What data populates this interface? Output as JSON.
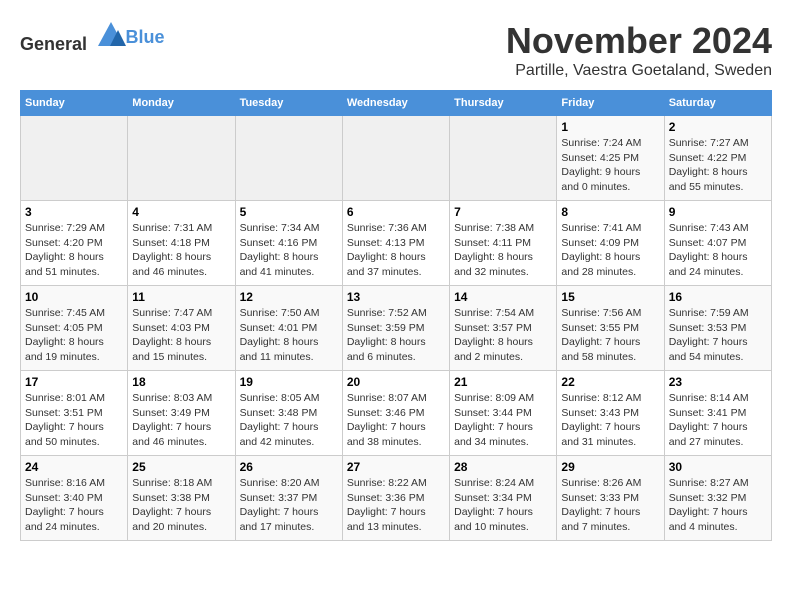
{
  "header": {
    "logo_general": "General",
    "logo_blue": "Blue",
    "month": "November 2024",
    "location": "Partille, Vaestra Goetaland, Sweden"
  },
  "weekdays": [
    "Sunday",
    "Monday",
    "Tuesday",
    "Wednesday",
    "Thursday",
    "Friday",
    "Saturday"
  ],
  "weeks": [
    [
      {
        "day": "",
        "info": ""
      },
      {
        "day": "",
        "info": ""
      },
      {
        "day": "",
        "info": ""
      },
      {
        "day": "",
        "info": ""
      },
      {
        "day": "",
        "info": ""
      },
      {
        "day": "1",
        "info": "Sunrise: 7:24 AM\nSunset: 4:25 PM\nDaylight: 9 hours\nand 0 minutes."
      },
      {
        "day": "2",
        "info": "Sunrise: 7:27 AM\nSunset: 4:22 PM\nDaylight: 8 hours\nand 55 minutes."
      }
    ],
    [
      {
        "day": "3",
        "info": "Sunrise: 7:29 AM\nSunset: 4:20 PM\nDaylight: 8 hours\nand 51 minutes."
      },
      {
        "day": "4",
        "info": "Sunrise: 7:31 AM\nSunset: 4:18 PM\nDaylight: 8 hours\nand 46 minutes."
      },
      {
        "day": "5",
        "info": "Sunrise: 7:34 AM\nSunset: 4:16 PM\nDaylight: 8 hours\nand 41 minutes."
      },
      {
        "day": "6",
        "info": "Sunrise: 7:36 AM\nSunset: 4:13 PM\nDaylight: 8 hours\nand 37 minutes."
      },
      {
        "day": "7",
        "info": "Sunrise: 7:38 AM\nSunset: 4:11 PM\nDaylight: 8 hours\nand 32 minutes."
      },
      {
        "day": "8",
        "info": "Sunrise: 7:41 AM\nSunset: 4:09 PM\nDaylight: 8 hours\nand 28 minutes."
      },
      {
        "day": "9",
        "info": "Sunrise: 7:43 AM\nSunset: 4:07 PM\nDaylight: 8 hours\nand 24 minutes."
      }
    ],
    [
      {
        "day": "10",
        "info": "Sunrise: 7:45 AM\nSunset: 4:05 PM\nDaylight: 8 hours\nand 19 minutes."
      },
      {
        "day": "11",
        "info": "Sunrise: 7:47 AM\nSunset: 4:03 PM\nDaylight: 8 hours\nand 15 minutes."
      },
      {
        "day": "12",
        "info": "Sunrise: 7:50 AM\nSunset: 4:01 PM\nDaylight: 8 hours\nand 11 minutes."
      },
      {
        "day": "13",
        "info": "Sunrise: 7:52 AM\nSunset: 3:59 PM\nDaylight: 8 hours\nand 6 minutes."
      },
      {
        "day": "14",
        "info": "Sunrise: 7:54 AM\nSunset: 3:57 PM\nDaylight: 8 hours\nand 2 minutes."
      },
      {
        "day": "15",
        "info": "Sunrise: 7:56 AM\nSunset: 3:55 PM\nDaylight: 7 hours\nand 58 minutes."
      },
      {
        "day": "16",
        "info": "Sunrise: 7:59 AM\nSunset: 3:53 PM\nDaylight: 7 hours\nand 54 minutes."
      }
    ],
    [
      {
        "day": "17",
        "info": "Sunrise: 8:01 AM\nSunset: 3:51 PM\nDaylight: 7 hours\nand 50 minutes."
      },
      {
        "day": "18",
        "info": "Sunrise: 8:03 AM\nSunset: 3:49 PM\nDaylight: 7 hours\nand 46 minutes."
      },
      {
        "day": "19",
        "info": "Sunrise: 8:05 AM\nSunset: 3:48 PM\nDaylight: 7 hours\nand 42 minutes."
      },
      {
        "day": "20",
        "info": "Sunrise: 8:07 AM\nSunset: 3:46 PM\nDaylight: 7 hours\nand 38 minutes."
      },
      {
        "day": "21",
        "info": "Sunrise: 8:09 AM\nSunset: 3:44 PM\nDaylight: 7 hours\nand 34 minutes."
      },
      {
        "day": "22",
        "info": "Sunrise: 8:12 AM\nSunset: 3:43 PM\nDaylight: 7 hours\nand 31 minutes."
      },
      {
        "day": "23",
        "info": "Sunrise: 8:14 AM\nSunset: 3:41 PM\nDaylight: 7 hours\nand 27 minutes."
      }
    ],
    [
      {
        "day": "24",
        "info": "Sunrise: 8:16 AM\nSunset: 3:40 PM\nDaylight: 7 hours\nand 24 minutes."
      },
      {
        "day": "25",
        "info": "Sunrise: 8:18 AM\nSunset: 3:38 PM\nDaylight: 7 hours\nand 20 minutes."
      },
      {
        "day": "26",
        "info": "Sunrise: 8:20 AM\nSunset: 3:37 PM\nDaylight: 7 hours\nand 17 minutes."
      },
      {
        "day": "27",
        "info": "Sunrise: 8:22 AM\nSunset: 3:36 PM\nDaylight: 7 hours\nand 13 minutes."
      },
      {
        "day": "28",
        "info": "Sunrise: 8:24 AM\nSunset: 3:34 PM\nDaylight: 7 hours\nand 10 minutes."
      },
      {
        "day": "29",
        "info": "Sunrise: 8:26 AM\nSunset: 3:33 PM\nDaylight: 7 hours\nand 7 minutes."
      },
      {
        "day": "30",
        "info": "Sunrise: 8:27 AM\nSunset: 3:32 PM\nDaylight: 7 hours\nand 4 minutes."
      }
    ]
  ]
}
